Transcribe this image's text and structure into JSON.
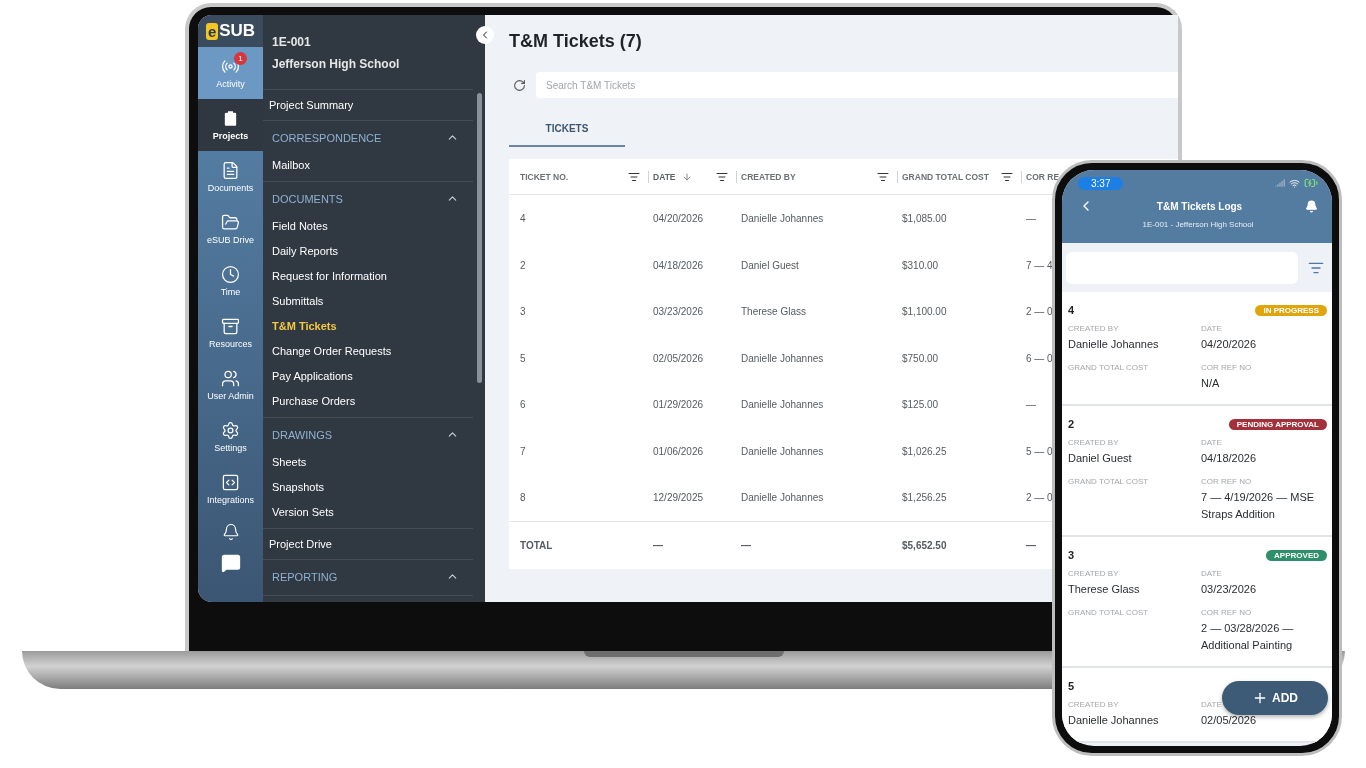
{
  "laptop": {
    "logo": {
      "mark": "e",
      "text": "SUB"
    },
    "rail": [
      {
        "kind": "activity",
        "label": "Activity",
        "selected": false,
        "highlighted": true,
        "badge": "1"
      },
      {
        "kind": "projects",
        "label": "Projects",
        "selected": true,
        "highlighted": false
      },
      {
        "kind": "documents",
        "label": "Documents",
        "selected": false,
        "highlighted": false
      },
      {
        "kind": "drive",
        "label": "eSUB Drive",
        "selected": false,
        "highlighted": false
      },
      {
        "kind": "time",
        "label": "Time",
        "selected": false,
        "highlighted": false
      },
      {
        "kind": "resources",
        "label": "Resources",
        "selected": false,
        "highlighted": false
      },
      {
        "kind": "users",
        "label": "User Admin",
        "selected": false,
        "highlighted": false
      },
      {
        "kind": "settings",
        "label": "Settings",
        "selected": false,
        "highlighted": false
      },
      {
        "kind": "integrations",
        "label": "Integrations",
        "selected": false,
        "highlighted": false
      }
    ],
    "project": {
      "code": "1E-001",
      "name": "Jefferson High School"
    },
    "nav": [
      {
        "kind": "link",
        "label": "Project Summary",
        "selected": false
      },
      {
        "kind": "section",
        "label": "CORRESPONDENCE",
        "expanded": true,
        "children": [
          {
            "label": "Mailbox",
            "selected": false
          }
        ]
      },
      {
        "kind": "section",
        "label": "DOCUMENTS",
        "expanded": true,
        "children": [
          {
            "label": "Field Notes",
            "selected": false
          },
          {
            "label": "Daily Reports",
            "selected": false
          },
          {
            "label": "Request for Information",
            "selected": false
          },
          {
            "label": "Submittals",
            "selected": false
          },
          {
            "label": "T&M Tickets",
            "selected": true
          },
          {
            "label": "Change Order Requests",
            "selected": false
          },
          {
            "label": "Pay Applications",
            "selected": false
          },
          {
            "label": "Purchase Orders",
            "selected": false
          }
        ]
      },
      {
        "kind": "section",
        "label": "DRAWINGS",
        "expanded": true,
        "children": [
          {
            "label": "Sheets",
            "selected": false
          },
          {
            "label": "Snapshots",
            "selected": false
          },
          {
            "label": "Version Sets",
            "selected": false
          }
        ]
      },
      {
        "kind": "link",
        "label": "Project Drive",
        "selected": false
      },
      {
        "kind": "section",
        "label": "REPORTING",
        "expanded": true
      }
    ],
    "title": "T&M Tickets (7)",
    "search": {
      "placeholder": "Search T&M Tickets"
    },
    "tabs": [
      {
        "label": "TICKETS",
        "selected": true
      }
    ],
    "table": {
      "columns": [
        {
          "label": "TICKET NO.",
          "sorted": false
        },
        {
          "label": "DATE",
          "sorted": true
        },
        {
          "label": "CREATED BY",
          "sorted": false
        },
        {
          "label": "GRAND TOTAL COST",
          "sorted": false
        },
        {
          "label": "COR RE",
          "sorted": false
        }
      ],
      "rows": [
        [
          "4",
          "04/20/2026",
          "Danielle Johannes",
          "$1,085.00",
          "—"
        ],
        [
          "2",
          "04/18/2026",
          "Daniel Guest",
          "$310.00",
          "7 — 4"
        ],
        [
          "3",
          "03/23/2026",
          "Therese Glass",
          "$1,100.00",
          "2 — 0"
        ],
        [
          "5",
          "02/05/2026",
          "Danielle Johannes",
          "$750.00",
          "6 — 0"
        ],
        [
          "6",
          "01/29/2026",
          "Danielle Johannes",
          "$125.00",
          "—"
        ],
        [
          "7",
          "01/06/2026",
          "Danielle Johannes",
          "$1,026.25",
          "5 — 0"
        ],
        [
          "8",
          "12/29/2025",
          "Danielle Johannes",
          "$1,256.25",
          "2 — 0"
        ]
      ],
      "total": [
        "TOTAL",
        "—",
        "—",
        "$5,652.50",
        "—"
      ]
    }
  },
  "phone": {
    "time": "3:37",
    "title": "T&M Tickets Logs",
    "subtitle": "1E-001 - Jefferson High School",
    "cards": [
      {
        "number": "4",
        "status": {
          "label": "IN PROGRESS",
          "color": "#e0a40c"
        },
        "fields": [
          {
            "label": "CREATED BY",
            "value": "Danielle  Johannes"
          },
          {
            "label": "DATE",
            "value": "04/20/2026"
          },
          {
            "label": "GRAND TOTAL COST"
          },
          {
            "label": "COR REF NO",
            "value": "N/A"
          }
        ]
      },
      {
        "number": "2",
        "status": {
          "label": "PENDING APPROVAL",
          "color": "#a3313b"
        },
        "fields": [
          {
            "label": "CREATED BY",
            "value": "Daniel  Guest"
          },
          {
            "label": "DATE",
            "value": "04/18/2026"
          },
          {
            "label": "GRAND TOTAL COST"
          },
          {
            "label": "COR REF NO",
            "value": "7 — 4/19/2026 — MSE Straps Addition"
          }
        ]
      },
      {
        "number": "3",
        "status": {
          "label": "APPROVED",
          "color": "#2f8f6a"
        },
        "fields": [
          {
            "label": "CREATED BY",
            "value": "Therese  Glass"
          },
          {
            "label": "DATE",
            "value": "03/23/2026"
          },
          {
            "label": "GRAND TOTAL COST"
          },
          {
            "label": "COR REF NO",
            "value": "2 — 03/28/2026 — Additional Painting"
          }
        ]
      },
      {
        "number": "5",
        "fields": [
          {
            "label": "CREATED BY",
            "value": "Danielle  Johannes"
          },
          {
            "label": "DATE",
            "value": "02/05/2026"
          }
        ]
      }
    ],
    "add_button": "ADD"
  }
}
